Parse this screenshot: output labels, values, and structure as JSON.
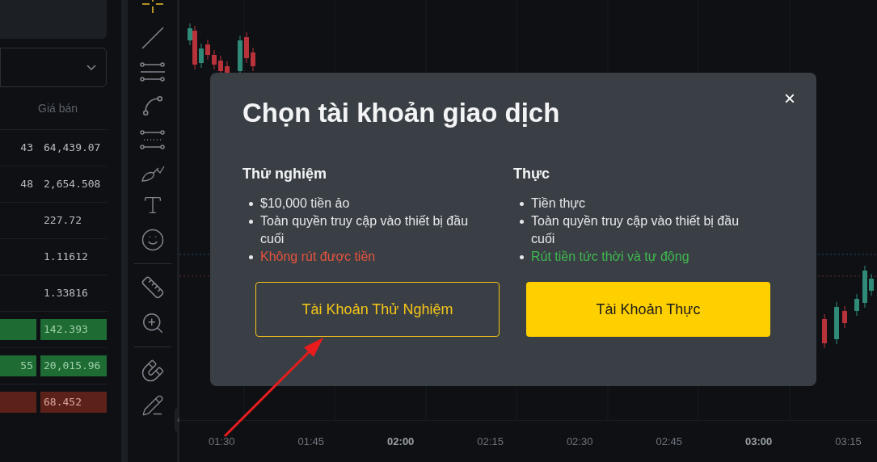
{
  "market_panel": {
    "column_header": "Giá bán",
    "rows": [
      {
        "column_1": "43",
        "price": "64,439.07",
        "kind": "none"
      },
      {
        "column_1": "48",
        "price": "2,654.508",
        "kind": "none"
      },
      {
        "price": "227.72",
        "kind": "none"
      },
      {
        "price": "1.11612",
        "kind": "none"
      },
      {
        "price": "1.33816",
        "kind": "none"
      },
      {
        "price": "142.393",
        "kind": "up"
      },
      {
        "column_1": "55",
        "price": "20,015.96",
        "kind": "up"
      },
      {
        "price": "68.452",
        "kind": "down"
      }
    ]
  },
  "time_axis": [
    {
      "label": "01:30",
      "bold": false
    },
    {
      "label": "01:45",
      "bold": false
    },
    {
      "label": "02:00",
      "bold": true
    },
    {
      "label": "02:15",
      "bold": false
    },
    {
      "label": "02:30",
      "bold": false
    },
    {
      "label": "02:45",
      "bold": false
    },
    {
      "label": "03:00",
      "bold": true
    },
    {
      "label": "03:15",
      "bold": false
    }
  ],
  "dialog": {
    "title": "Chọn tài khoản giao dịch",
    "close": "×",
    "accounts": [
      {
        "heading": "Thử nghiệm",
        "button": "Tài Khoản Thử Nghiệm",
        "kind": "outline",
        "features": [
          {
            "text": "$10,000 tiền ảo",
            "kind": "plain"
          },
          {
            "text": "Toàn quyền truy cập vào thiết bị đầu cuối",
            "kind": "plain"
          },
          {
            "text": "Không rút được tiền",
            "kind": "negative"
          }
        ]
      },
      {
        "heading": "Thực",
        "button": "Tài Khoản Thực",
        "kind": "filled",
        "features": [
          {
            "text": "Tiền thực",
            "kind": "plain"
          },
          {
            "text": "Toàn quyền truy cập vào thiết bị đầu cuối",
            "kind": "plain"
          },
          {
            "text": "Rút tiền tức thời và tự động",
            "kind": "positive"
          }
        ]
      }
    ]
  }
}
